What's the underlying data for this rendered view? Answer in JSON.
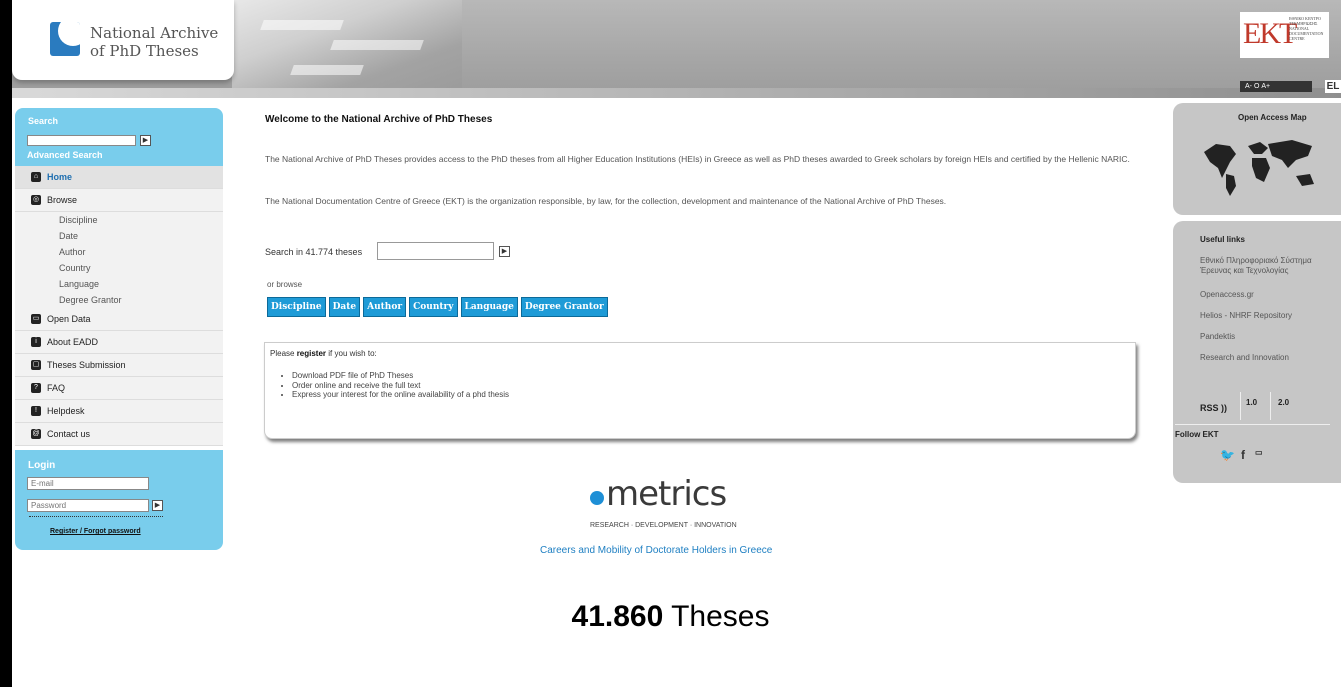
{
  "header": {
    "site_title_line1": "National Archive",
    "site_title_line2": "of PhD Theses",
    "partner_logo": "EKT",
    "partner_logo_small": "ΕΘΝΙΚΟ ΚΕΝΤΡΟ ΤΕΚΜΗΡΙΩΣΗΣ NATIONAL DOCUMENTATION CENTRE",
    "font_size_controls": "A- Ο A+",
    "language_toggle": "EL"
  },
  "sidebar": {
    "search_label": "Search",
    "advanced_search": "Advanced Search",
    "nav": [
      {
        "label": "Home",
        "icon": "home-icon"
      },
      {
        "label": "Browse",
        "icon": "browse-icon"
      },
      {
        "label": "Open Data",
        "icon": "open-data-icon"
      },
      {
        "label": "About EADD",
        "icon": "info-icon"
      },
      {
        "label": "Theses Submission",
        "icon": "document-icon"
      },
      {
        "label": "FAQ",
        "icon": "faq-icon"
      },
      {
        "label": "Helpdesk",
        "icon": "helpdesk-icon"
      },
      {
        "label": "Contact us",
        "icon": "contact-icon"
      }
    ],
    "browse_sub": [
      "Discipline",
      "Date",
      "Author",
      "Country",
      "Language",
      "Degree Grantor"
    ],
    "login": {
      "title": "Login",
      "email_placeholder": "E-mail",
      "password_placeholder": "Password",
      "register_link": "Register",
      "separator": " / ",
      "forgot_link": "Forgot password"
    }
  },
  "main": {
    "welcome_title": "Welcome to the National Archive of PhD Theses",
    "intro_1": "The National Archive of PhD Theses provides access to the PhD theses from all Higher Education Institutions (HEIs) in Greece as well as PhD theses awarded to Greek scholars by foreign HEIs and certified by the Hellenic NARIC.",
    "intro_2": "The National Documentation Centre of Greece (EKT) is the organization responsible, by law, for the collection, development and maintenance of the National Archive of PhD Theses.",
    "search_label": "Search in 41.774 theses",
    "browse_label": "or browse",
    "browse_buttons": [
      "Discipline",
      "Date",
      "Author",
      "Country",
      "Language",
      "Degree Grantor"
    ],
    "register_prefix": "Please ",
    "register_word": "register",
    "register_suffix": " if you wish to:",
    "register_items": [
      "Download PDF file of PhD Theses",
      "Order online and receive the full text",
      "Express your interest for the online availability of a phd thesis"
    ],
    "emetrics_name": "metrics",
    "emetrics_tagline": "RESEARCH · DEVELOPMENT · INNOVATION",
    "emetrics_link": "Careers and Mobility of Doctorate Holders in Greece",
    "thesis_count": "41.860",
    "thesis_count_label": " Theses"
  },
  "right": {
    "open_access_title": "Open Access Map",
    "useful_links_title": "Useful links",
    "useful_links": [
      "Εθνικό Πληροφοριακό Σύστημα Έρευνας και Τεχνολογίας",
      "Openaccess.gr",
      "Helios - NHRF Repository",
      "Pandektis",
      "Research and Innovation"
    ],
    "rss_label": "RSS",
    "rss_v1": "1.0",
    "rss_v2": "2.0",
    "follow_title": "Follow EKT"
  }
}
